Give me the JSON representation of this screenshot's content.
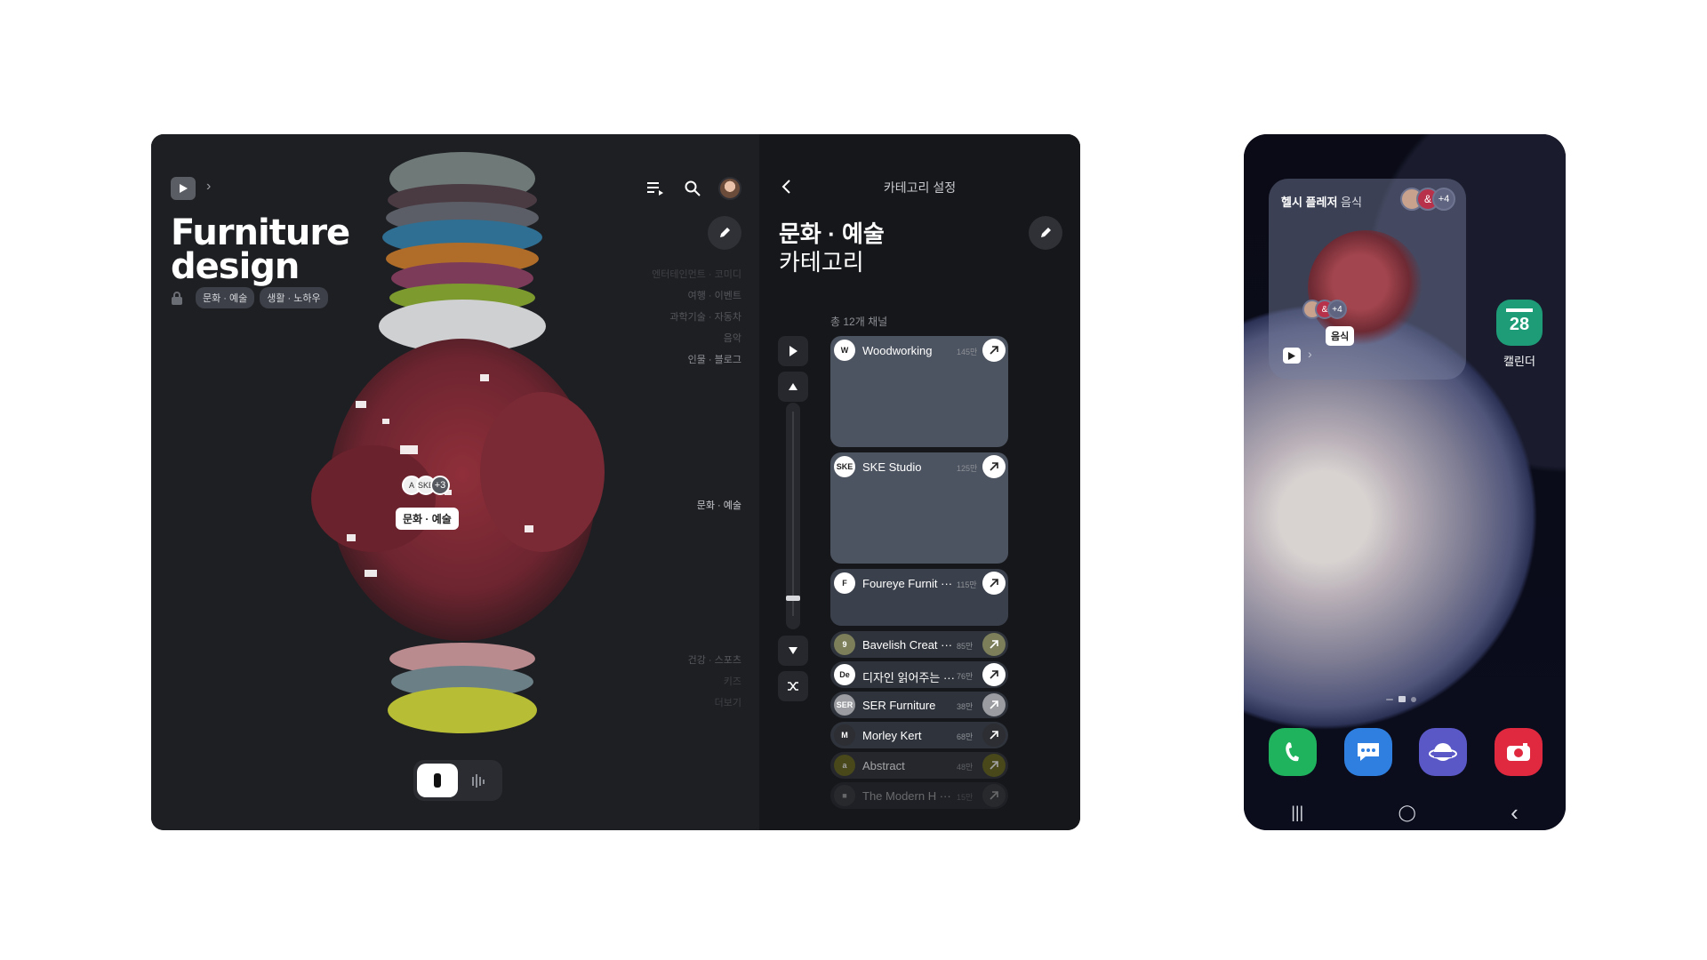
{
  "tablet": {
    "left": {
      "title_line1": "Furniture",
      "title_line2": "design",
      "tags": [
        "문화 · 예술",
        "생활 · 노하우"
      ],
      "category_labels": [
        {
          "text": "엔터테인먼트 · 코미디",
          "tone": "faint"
        },
        {
          "text": "여행 · 이벤트",
          "tone": "dim"
        },
        {
          "text": "과학기술 · 자동차",
          "tone": "dim"
        },
        {
          "text": "음악",
          "tone": "dim"
        },
        {
          "text": "인물 · 블로그",
          "tone": "normal"
        }
      ],
      "category_center": "문화 · 예술",
      "category_lower": [
        {
          "text": "건강 · 스포츠",
          "tone": "dim"
        },
        {
          "text": "키즈",
          "tone": "faint"
        },
        {
          "text": "더보기",
          "tone": "faint"
        }
      ],
      "cluster_label": "문화 · 예술",
      "cluster_avatar_a": "A",
      "cluster_avatar_b": "SKE",
      "cluster_count": "+3"
    },
    "right": {
      "header": "카테고리 설정",
      "title_line1": "문화 · 예술",
      "title_line2": "카테고리",
      "channel_count": "총 12개 채널",
      "channels": [
        {
          "name": "Woodworking",
          "subs": "145만",
          "logo": "W",
          "size": "big"
        },
        {
          "name": "SKE Studio",
          "subs": "125만",
          "logo": "SKE",
          "size": "big"
        },
        {
          "name": "Foureye Furnit ···",
          "subs": "115만",
          "logo": "F",
          "size": "mid"
        },
        {
          "name": "Bavelish Creat ···",
          "subs": "85만",
          "logo": "9",
          "size": "row",
          "tint": "#7c7f5a"
        },
        {
          "name": "디자인 읽어주는 ···",
          "subs": "76만",
          "logo": "De",
          "size": "row",
          "tint": "#ffffff"
        },
        {
          "name": "SER Furniture",
          "subs": "38만",
          "logo": "SER",
          "size": "row",
          "tint": "#9a9ca1"
        },
        {
          "name": "Morley Kert",
          "subs": "68만",
          "logo": "M",
          "size": "row",
          "tint": "#2d2e33"
        },
        {
          "name": "Abstract",
          "subs": "48만",
          "logo": "a",
          "size": "row",
          "tint": "#6a6a1c"
        },
        {
          "name": "The Modern H ···",
          "subs": "15만",
          "logo": "■",
          "size": "row",
          "tint": "#4a4c52"
        }
      ]
    }
  },
  "phone": {
    "widget_title": "헬시 플레저",
    "widget_sub": "음식",
    "widget_count": "+4",
    "widget_avatar": "&",
    "widget_label": "음식",
    "widget_mini_count": "+4",
    "widget_mini_avatar": "&",
    "calendar_day": "28",
    "calendar_label": "캘린더",
    "nav": {
      "recent": "|||",
      "home": "◯",
      "back": "‹"
    },
    "colors": {
      "phone_app": "#1fb35e",
      "messages_app": "#2f7fe0",
      "internet_app": "#5a57c6",
      "camera_app": "#e0293f"
    }
  }
}
